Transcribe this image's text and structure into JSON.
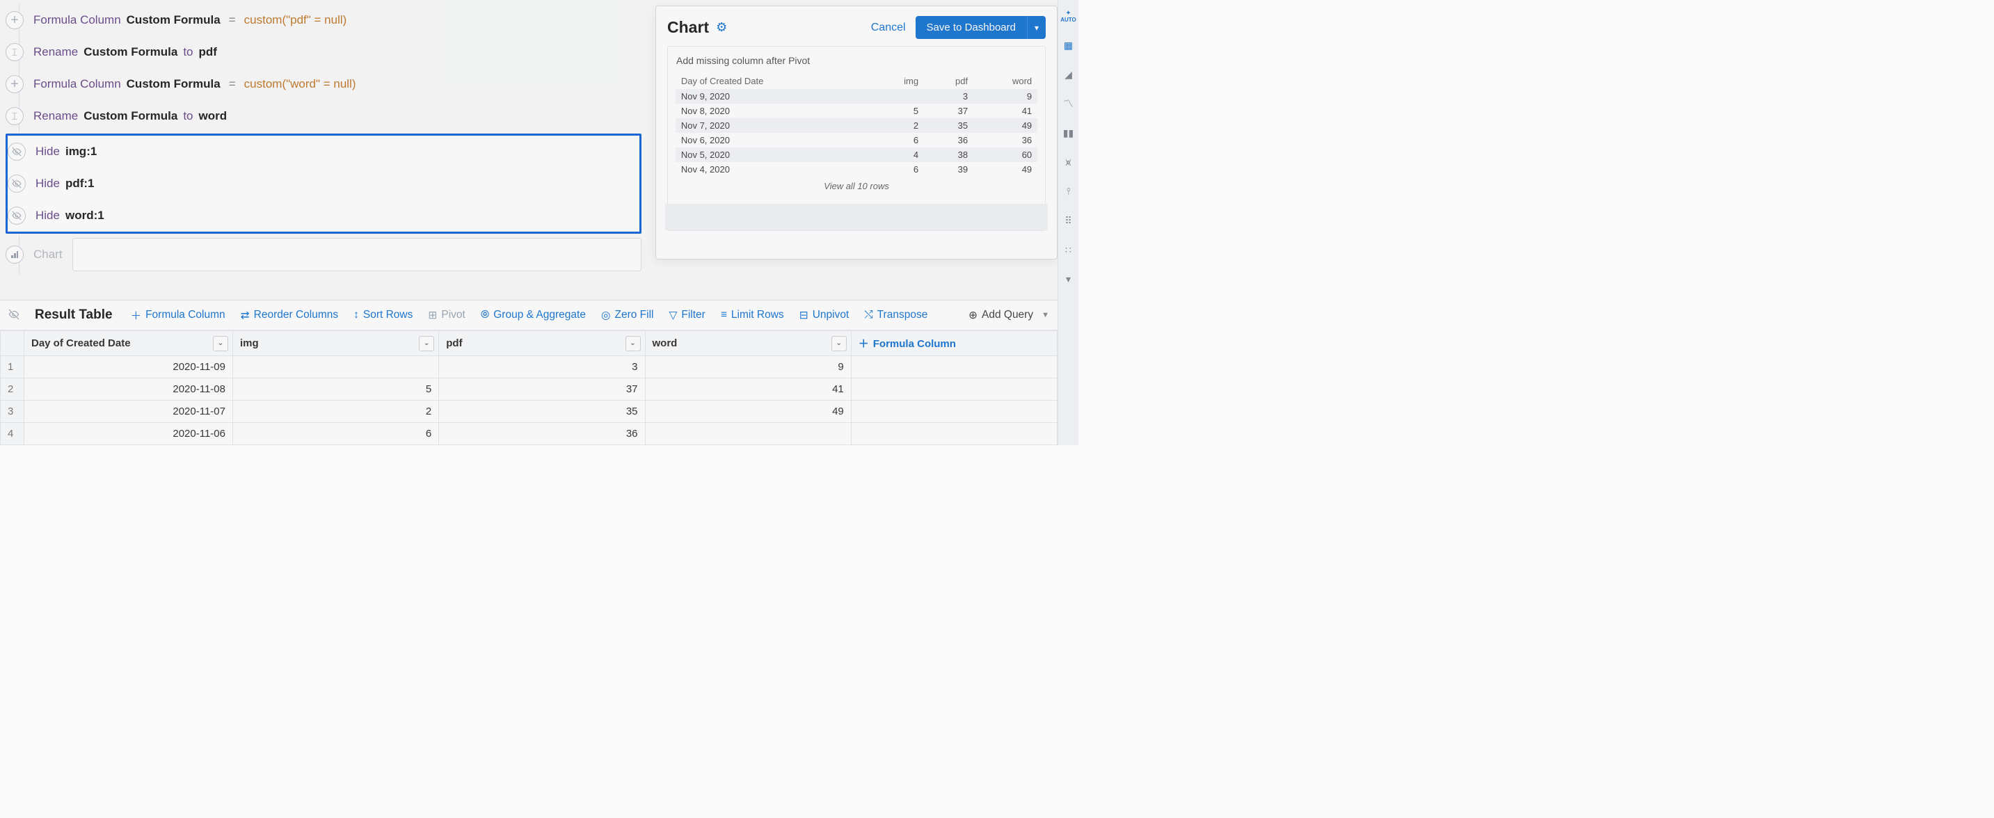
{
  "steps": {
    "fc1_label": "Formula Column",
    "fc1_name": "Custom Formula",
    "fc1_expr": "custom(\"pdf\" = null)",
    "rn1_prefix": "Rename",
    "rn1_from": "Custom Formula",
    "rn1_to_word": "to",
    "rn1_to": "pdf",
    "fc2_label": "Formula Column",
    "fc2_name": "Custom Formula",
    "fc2_expr": "custom(\"word\" = null)",
    "rn2_prefix": "Rename",
    "rn2_from": "Custom Formula",
    "rn2_to_word": "to",
    "rn2_to": "word",
    "hide1_prefix": "Hide",
    "hide1_col": "img:1",
    "hide2_prefix": "Hide",
    "hide2_col": "pdf:1",
    "hide3_prefix": "Hide",
    "hide3_col": "word:1",
    "chart_placeholder": "Chart"
  },
  "chart_panel": {
    "title": "Chart",
    "cancel": "Cancel",
    "save": "Save to Dashboard",
    "msg": "Add missing column after Pivot",
    "headers": {
      "c0": "Day of Created Date",
      "c1": "img",
      "c2": "pdf",
      "c3": "word"
    },
    "rows": [
      {
        "d": "Nov 9, 2020",
        "img": "",
        "pdf": "3",
        "word": "9"
      },
      {
        "d": "Nov 8, 2020",
        "img": "5",
        "pdf": "37",
        "word": "41"
      },
      {
        "d": "Nov 7, 2020",
        "img": "2",
        "pdf": "35",
        "word": "49"
      },
      {
        "d": "Nov 6, 2020",
        "img": "6",
        "pdf": "36",
        "word": "36"
      },
      {
        "d": "Nov 5, 2020",
        "img": "4",
        "pdf": "38",
        "word": "60"
      },
      {
        "d": "Nov 4, 2020",
        "img": "6",
        "pdf": "39",
        "word": "49"
      }
    ],
    "view_all": "View all 10 rows"
  },
  "toolbar": {
    "result_title": "Result Table",
    "formula_col": "Formula Column",
    "reorder": "Reorder Columns",
    "sort": "Sort Rows",
    "pivot": "Pivot",
    "group": "Group & Aggregate",
    "zero": "Zero Fill",
    "filter": "Filter",
    "limit": "Limit Rows",
    "unpivot": "Unpivot",
    "transpose": "Transpose",
    "add_query": "Add Query"
  },
  "grid": {
    "headers": {
      "h0": "Day of Created Date",
      "h1": "img",
      "h2": "pdf",
      "h3": "word",
      "h4": "Formula Column"
    },
    "rows": [
      {
        "n": "1",
        "d": "2020-11-09",
        "img": "",
        "pdf": "3",
        "word": "9"
      },
      {
        "n": "2",
        "d": "2020-11-08",
        "img": "5",
        "pdf": "37",
        "word": "41"
      },
      {
        "n": "3",
        "d": "2020-11-07",
        "img": "2",
        "pdf": "35",
        "word": "49"
      },
      {
        "n": "4",
        "d": "2020-11-06",
        "img": "6",
        "pdf": "36",
        "word": ""
      }
    ]
  },
  "sidebar": {
    "auto": "AUTO"
  },
  "chart_data": {
    "type": "table",
    "title": "Chart",
    "columns": [
      "Day of Created Date",
      "img",
      "pdf",
      "word"
    ],
    "rows": [
      [
        "Nov 9, 2020",
        null,
        3,
        9
      ],
      [
        "Nov 8, 2020",
        5,
        37,
        41
      ],
      [
        "Nov 7, 2020",
        2,
        35,
        49
      ],
      [
        "Nov 6, 2020",
        6,
        36,
        36
      ],
      [
        "Nov 5, 2020",
        4,
        38,
        60
      ],
      [
        "Nov 4, 2020",
        6,
        39,
        49
      ]
    ],
    "total_rows": 10
  }
}
